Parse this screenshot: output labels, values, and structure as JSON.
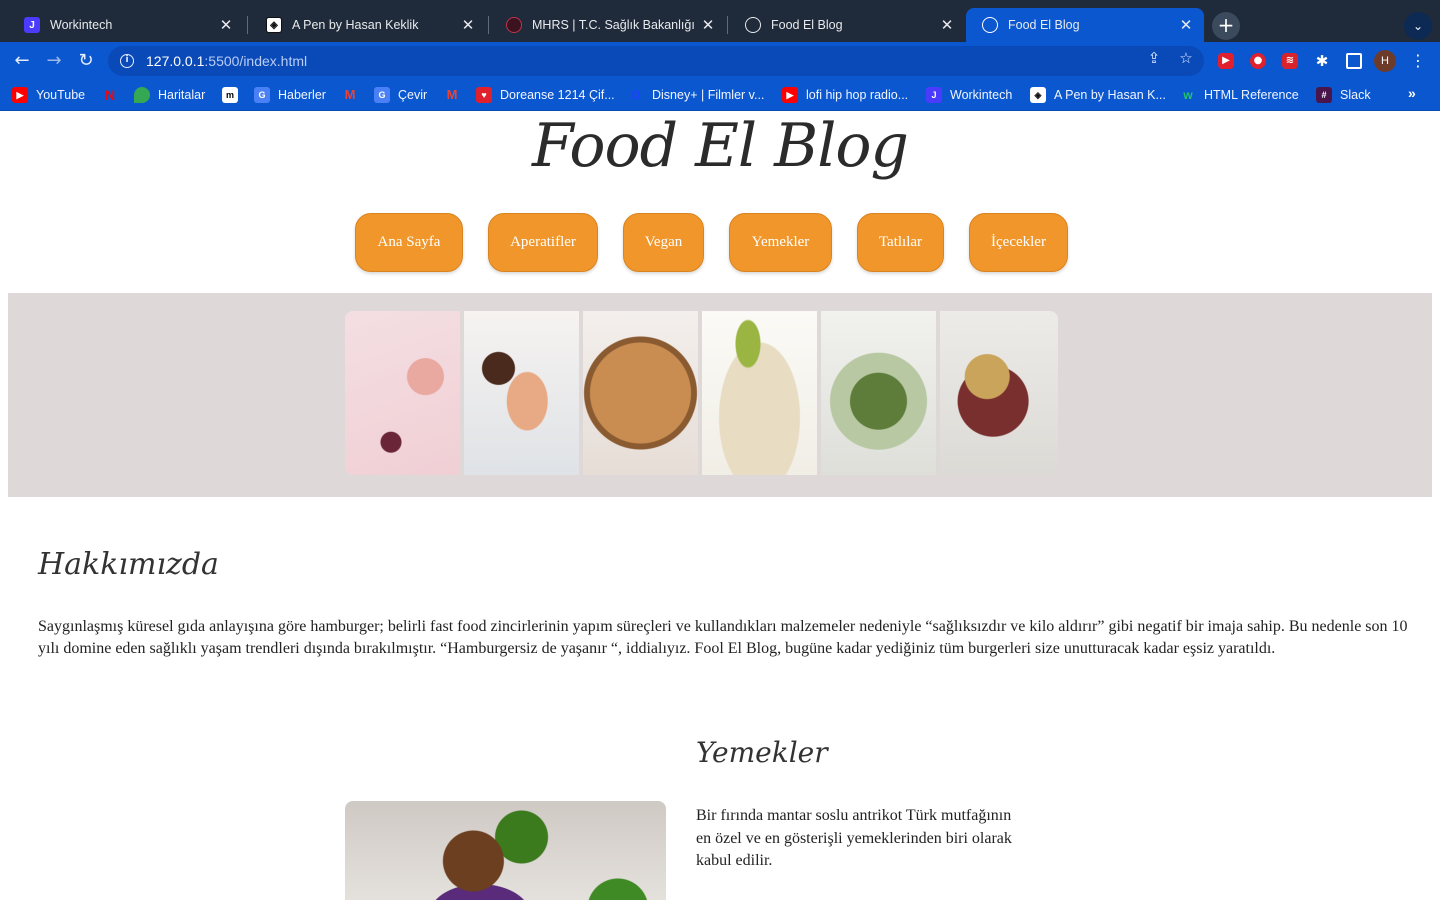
{
  "browser": {
    "tabs": [
      {
        "title": "Workintech",
        "icon": "workintech-icon",
        "active": false
      },
      {
        "title": "A Pen by Hasan Keklik",
        "icon": "codepen-icon",
        "active": false
      },
      {
        "title": "MHRS | T.C. Sağlık Bakanlığı",
        "icon": "mhrs-icon",
        "active": false
      },
      {
        "title": "Food El Blog",
        "icon": "globe-icon",
        "active": false
      },
      {
        "title": "Food El Blog",
        "icon": "globe-icon",
        "active": true
      }
    ],
    "url_host": "127.0.0.1",
    "url_path": ":5500/index.html",
    "profile_initial": "H",
    "bookmarks": [
      {
        "label": "YouTube",
        "icon": "youtube-icon"
      },
      {
        "label": "",
        "icon": "netflix-icon"
      },
      {
        "label": "Haritalar",
        "icon": "maps-icon"
      },
      {
        "label": "",
        "icon": "medium-icon"
      },
      {
        "label": "Haberler",
        "icon": "google-news-icon"
      },
      {
        "label": "",
        "icon": "gmail-icon"
      },
      {
        "label": "Çevir",
        "icon": "google-translate-icon"
      },
      {
        "label": "",
        "icon": "gmail-icon"
      },
      {
        "label": "Doreanse 1214 Çif...",
        "icon": "heart-icon"
      },
      {
        "label": "Disney+ | Filmler v...",
        "icon": "disney-icon"
      },
      {
        "label": "lofi hip hop radio...",
        "icon": "youtube-icon"
      },
      {
        "label": "Workintech",
        "icon": "workintech-icon"
      },
      {
        "label": "A Pen by Hasan K...",
        "icon": "codepen-icon"
      },
      {
        "label": "HTML Reference",
        "icon": "w3-icon"
      },
      {
        "label": "Slack",
        "icon": "slack-icon"
      }
    ],
    "bookmarks_overflow": "»"
  },
  "site": {
    "logo": "Food El Blog",
    "nav": [
      "Ana Sayfa",
      "Aperatifler",
      "Vegan",
      "Yemekler",
      "Tatlılar",
      "İçecekler"
    ],
    "accent_color": "#f0962a",
    "hero_bg": "#ded9d8",
    "gallery": [
      "chia-pudding-jar-photo",
      "reindeer-dessert-photo",
      "pie-photo",
      "pear-dish-photo",
      "salad-bowl-photo",
      "grain-bowl-photo"
    ],
    "about": {
      "title": "Hakkımızda",
      "text": "Saygınlaşmış küresel gıda anlayışına göre hamburger; belirli fast food zincirlerinin yapım süreçleri ve kullandıkları malzemeler nedeniyle “sağlıksızdır ve kilo aldırır” gibi negatif bir imaja sahip. Bu nedenle son 10 yılı domine eden sağlıklı yaşam trendleri dışında bırakılmıştır. “Hamburgersiz de yaşanır “, iddialıyız. Fool El Blog, bugüne kadar yediğiniz tüm burgerleri size unutturacak kadar eşsiz yaratıldı."
    },
    "food": {
      "title": "Yemekler",
      "text": "Bir fırında mantar soslu antrikot Türk mutfağının en özel ve en gösterişli yemeklerinden biri olarak kabul edilir."
    }
  }
}
